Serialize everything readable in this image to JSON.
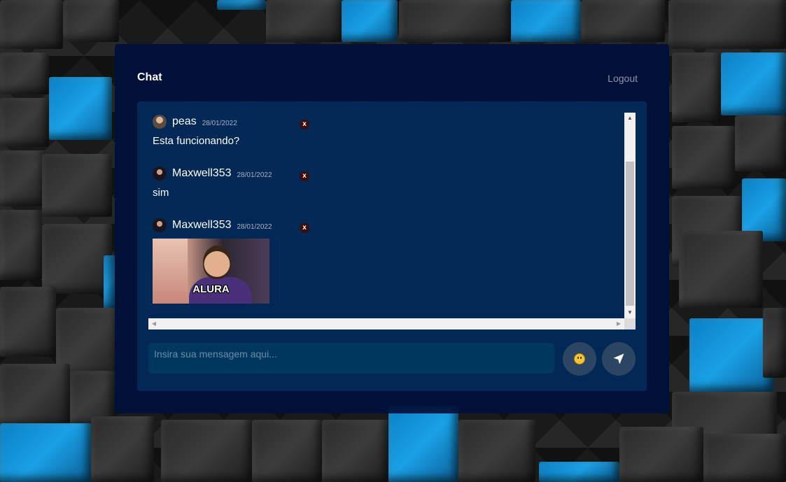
{
  "header": {
    "title": "Chat",
    "logout_label": "Logout"
  },
  "messages": [
    {
      "username": "peas",
      "date": "28/01/2022",
      "text": "Esta funcionando?",
      "delete_label": "x",
      "avatar": "avatar-photo"
    },
    {
      "username": "Maxwell353",
      "date": "28/01/2022",
      "text": "sim",
      "delete_label": "x",
      "avatar": "avatar-photo-dark"
    },
    {
      "username": "Maxwell353",
      "date": "28/01/2022",
      "sticker_caption": "ALURA",
      "delete_label": "x",
      "avatar": "avatar-photo-dark"
    }
  ],
  "composer": {
    "placeholder": "Insira sua mensagem aqui...",
    "emoji_icon": "smiley-icon",
    "send_icon": "send-arrow-icon"
  },
  "colors": {
    "panel_bg": "#00103a",
    "chat_bg": "#022d5a",
    "button_bg": "#2b4563",
    "delete_bg": "#3d0d0d",
    "accent_blue": "#1aa0e6"
  }
}
